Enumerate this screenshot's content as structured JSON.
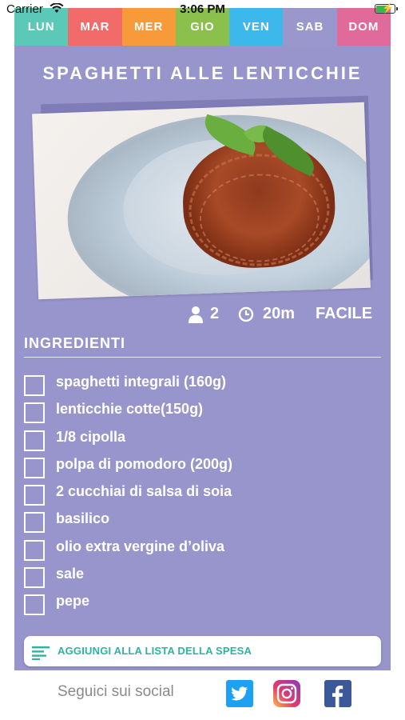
{
  "status_bar": {
    "carrier": "Carrier",
    "time": "3:06 PM"
  },
  "tabs": [
    {
      "label": "LUN",
      "color": "#5cc8b8"
    },
    {
      "label": "MAR",
      "color": "#f26b6b"
    },
    {
      "label": "MER",
      "color": "#f79a3a"
    },
    {
      "label": "GIO",
      "color": "#8cc04d"
    },
    {
      "label": "VEN",
      "color": "#3db8ea"
    },
    {
      "label": "SAB",
      "color": "#9a97cd",
      "active": true
    },
    {
      "label": "DOM",
      "color": "#e06a9a"
    }
  ],
  "recipe": {
    "title": "SPAGHETTI ALLE LENTICCHIE",
    "servings": "2",
    "duration": "20m",
    "difficulty": "FACILE"
  },
  "ingredients": {
    "title": "INGREDIENTI",
    "items": [
      "spaghetti integrali (160g)",
      "lenticchie cotte(150g)",
      "1/8 cipolla",
      "polpa di pomodoro (200g)",
      "2 cucchiai di salsa di soia",
      "basilico",
      "olio extra vergine d’oliva",
      "sale",
      "pepe"
    ]
  },
  "add_to_list": {
    "label": "AGGIUNGI ALLA LISTA DELLA SPESA"
  },
  "footer": {
    "follow_text": "Seguici sui social"
  },
  "colors": {
    "card_background": "#9895cc",
    "accent_teal": "#2fb3a0",
    "twitter": "#1da1f2",
    "facebook": "#3b5998"
  },
  "icons": {
    "servings": "person-icon",
    "duration": "clock-icon",
    "list": "list-icon",
    "social": [
      "twitter-icon",
      "instagram-icon",
      "facebook-icon"
    ]
  }
}
